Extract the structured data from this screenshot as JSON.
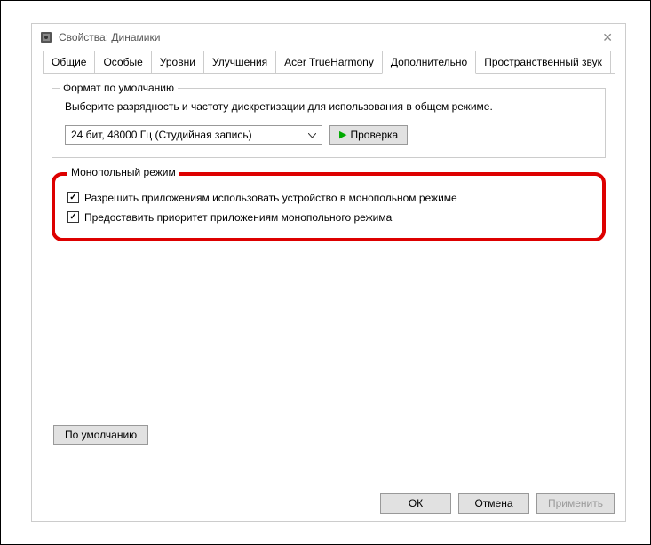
{
  "window": {
    "title": "Свойства: Динамики"
  },
  "tabs": [
    {
      "label": "Общие"
    },
    {
      "label": "Особые"
    },
    {
      "label": "Уровни"
    },
    {
      "label": "Улучшения"
    },
    {
      "label": "Acer TrueHarmony"
    },
    {
      "label": "Дополнительно",
      "active": true
    },
    {
      "label": "Пространственный звук"
    }
  ],
  "default_format": {
    "legend": "Формат по умолчанию",
    "text": "Выберите разрядность и частоту дискретизации для использования в общем режиме.",
    "select_value": "24 бит, 48000 Гц (Студийная запись)",
    "test_label": "Проверка"
  },
  "exclusive_mode": {
    "legend": "Монопольный режим",
    "checkbox1_label": "Разрешить приложениям использовать устройство в монопольном режиме",
    "checkbox1_checked": true,
    "checkbox2_label": "Предоставить приоритет приложениям монопольного режима",
    "checkbox2_checked": true
  },
  "defaults_btn": "По умолчанию",
  "footer": {
    "ok": "ОК",
    "cancel": "Отмена",
    "apply": "Применить"
  }
}
